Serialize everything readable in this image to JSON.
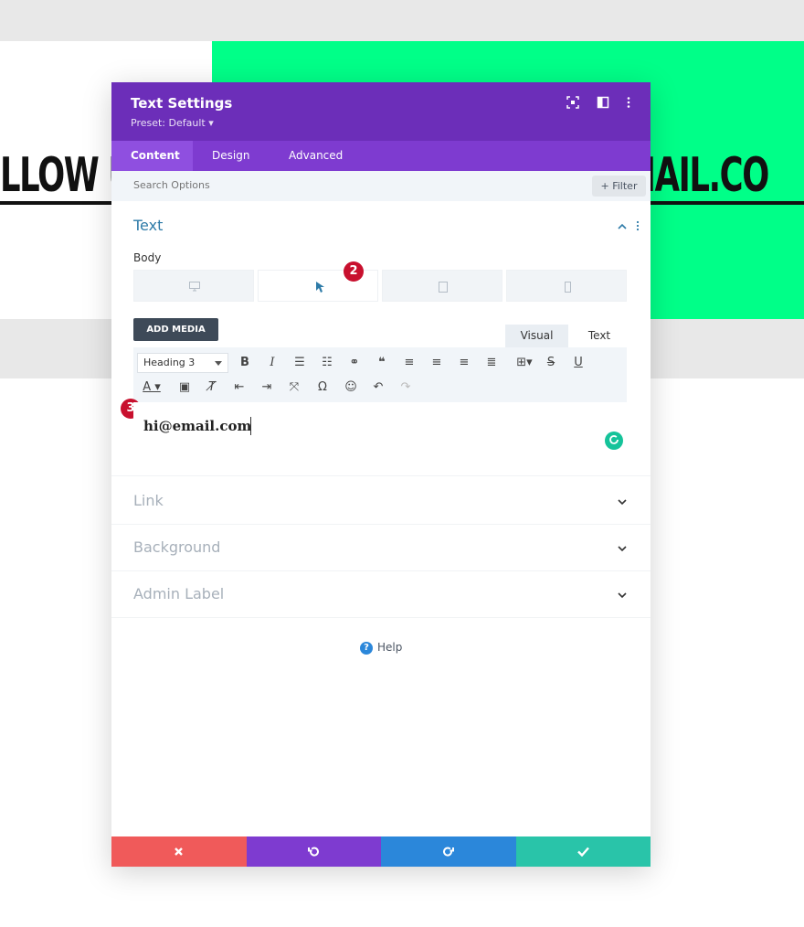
{
  "background": {
    "left_text": "LLOW U",
    "right_text": "EMAIL.CO"
  },
  "modal": {
    "title": "Text Settings",
    "preset": "Preset: Default ▾",
    "tabs": [
      {
        "label": "Content"
      },
      {
        "label": "Design"
      },
      {
        "label": "Advanced"
      }
    ],
    "search": {
      "placeholder": "Search Options"
    },
    "filter_label": "+ Filter",
    "sections": {
      "text": {
        "title": "Text",
        "body_label": "Body",
        "add_media_label": "ADD MEDIA",
        "editor_tabs": [
          "Visual",
          "Text"
        ],
        "heading_select": "Heading 3",
        "content": "hi@email.com"
      },
      "link": "Link",
      "background": "Background",
      "admin_label": "Admin Label"
    },
    "help_label": "Help",
    "badges": {
      "step2": "2",
      "step3": "3"
    },
    "footer_colors": {
      "cancel": "#f05a5a",
      "undo": "#7e3bd0",
      "redo": "#2b87da",
      "save": "#29c4a9"
    }
  },
  "colors": {
    "header": "#6c2eb9",
    "tabs": "#7e3bd0",
    "accent_green": "#00ff88",
    "section_title": "#2e7ba8"
  }
}
